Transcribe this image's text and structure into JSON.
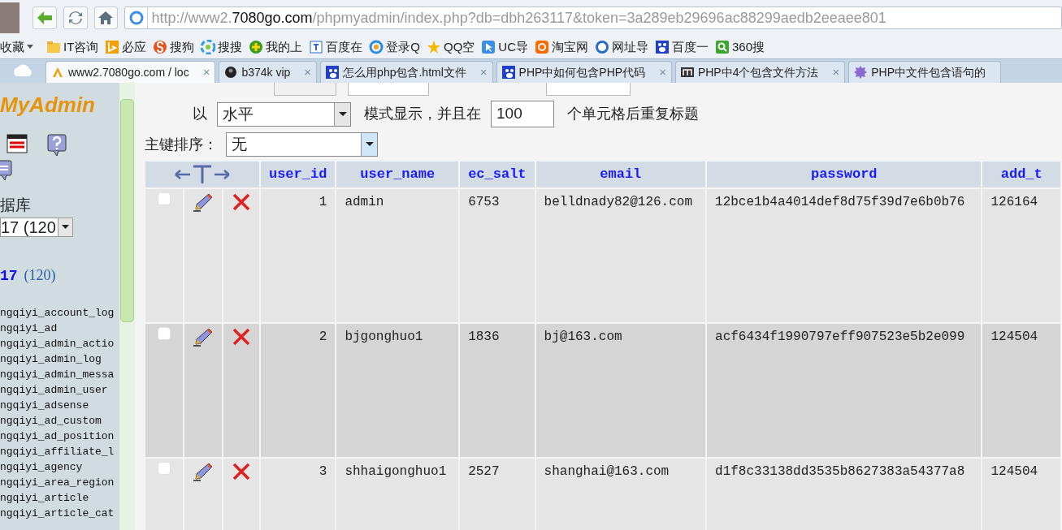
{
  "address": {
    "prefix": "http://www2.",
    "domain": "7080go.com",
    "rest": "/phpmyadmin/index.php?db=dbh263117&token=3a289eb29696ac88299aedb2eeaee801"
  },
  "bookmarks": [
    {
      "label": "收藏",
      "kind": "menu"
    },
    {
      "label": "IT咨询",
      "kind": "folder"
    },
    {
      "label": "必应",
      "kind": "bing"
    },
    {
      "label": "搜狗",
      "kind": "sogou"
    },
    {
      "label": "搜搜",
      "kind": "soso"
    },
    {
      "label": "我的上",
      "kind": "plus"
    },
    {
      "label": "百度在",
      "kind": "translate"
    },
    {
      "label": "登录Q",
      "kind": "ring"
    },
    {
      "label": "QQ空",
      "kind": "star"
    },
    {
      "label": "UC导",
      "kind": "cursor"
    },
    {
      "label": "淘宝网",
      "kind": "taobao"
    },
    {
      "label": "网址导",
      "kind": "scircle"
    },
    {
      "label": "百度一",
      "kind": "paw"
    },
    {
      "label": "360搜",
      "kind": "search"
    }
  ],
  "tabs": [
    {
      "label": "www2.7080go.com / loc",
      "selected": true,
      "kind": "pma",
      "close": "×"
    },
    {
      "label": "b374k vip",
      "selected": false,
      "kind": "dark",
      "close": "×"
    },
    {
      "label": "怎么用php包含.html文件",
      "selected": false,
      "kind": "paw",
      "close": "×"
    },
    {
      "label": "PHP中如何包含PHP代码",
      "selected": false,
      "kind": "paw",
      "close": "×"
    },
    {
      "label": "PHP中4个包含文件方法",
      "selected": false,
      "kind": "m",
      "close": "×"
    },
    {
      "label": "PHP中文件包含语句的",
      "selected": false,
      "kind": "php"
    }
  ],
  "sidebar": {
    "logo": "MyAdmin",
    "db_label": "据库",
    "db_select": "17 (120",
    "db_link": "17",
    "db_count": "(120)",
    "tables": [
      "ngqiyi_account_log",
      "ngqiyi_ad",
      "ngqiyi_admin_actio",
      "ngqiyi_admin_log",
      "ngqiyi_admin_messa",
      "ngqiyi_admin_user",
      "ngqiyi_adsense",
      "ngqiyi_ad_custom",
      "ngqiyi_ad_position",
      "ngqiyi_affiliate_l",
      "ngqiyi_agency",
      "ngqiyi_area_region",
      "ngqiyi_article",
      "ngqiyi_article_cat"
    ]
  },
  "display_options": {
    "prefix": "以",
    "mode": "水平",
    "middle": "模式显示，并且在",
    "repeat": "100",
    "suffix": "个单元格后重复标题",
    "sort_label": "主键排序：",
    "sort": "无"
  },
  "table": {
    "columns": [
      "user_id",
      "user_name",
      "ec_salt",
      "email",
      "password",
      "add_t"
    ],
    "rows": [
      {
        "checked": false,
        "cells": [
          "1",
          "admin",
          "6753",
          "belldnady82@126.com",
          "12bce1b4a4014def8d75f39d7e6b0b76",
          "126164"
        ]
      },
      {
        "checked": false,
        "cells": [
          "2",
          "bjgonghuo1",
          "1836",
          "bj@163.com",
          "acf6434f1990797eff907523e5b2e099",
          "124504"
        ]
      },
      {
        "checked": false,
        "cells": [
          "3",
          "shhaigonghuo1",
          "2527",
          "shanghai@163.com",
          "d1f8c33138dd3535b8627383a54377a8",
          "124504"
        ]
      }
    ]
  }
}
